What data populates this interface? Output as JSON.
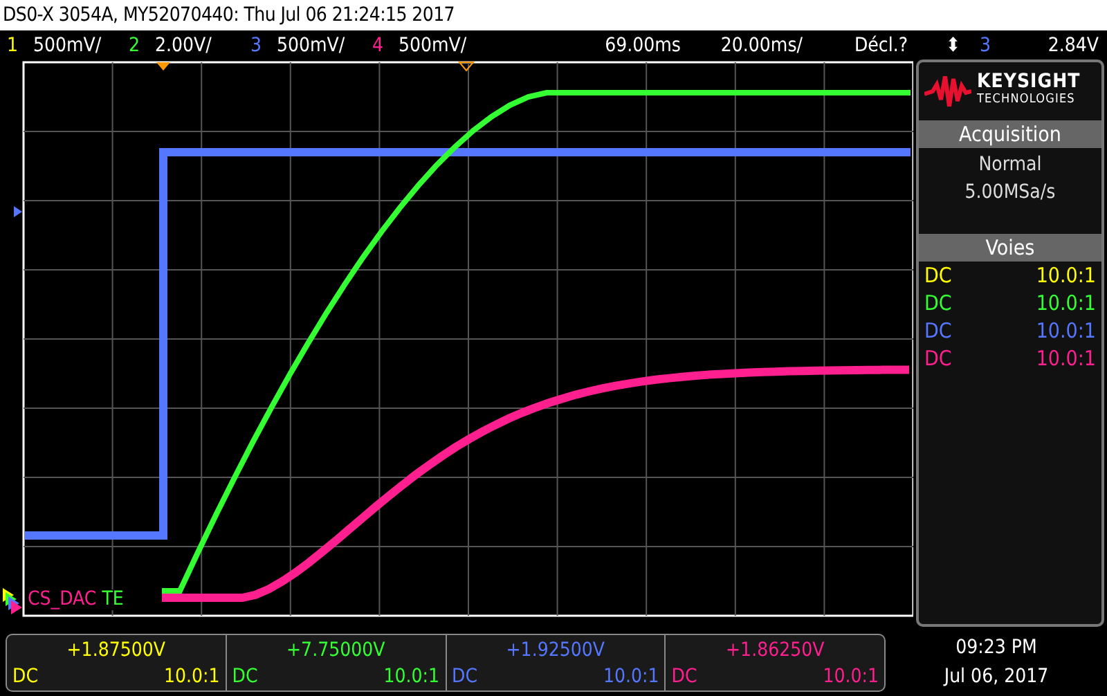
{
  "window": {
    "title": "DS0-X 3054A, MY52070440: Thu Jul 06 21:24:15 2017"
  },
  "channels": [
    {
      "number": "1",
      "scale": "500mV/",
      "color": "#ffff00"
    },
    {
      "number": "2",
      "scale": "2.00V/",
      "color": "#33ff33"
    },
    {
      "number": "3",
      "scale": "500mV/",
      "color": "#5577ff"
    },
    {
      "number": "4",
      "scale": "500mV/",
      "color": "#ff1f8f"
    }
  ],
  "timebase": {
    "delay": "69.00ms",
    "scale": "20.00ms/"
  },
  "trigger": {
    "mode": "Décl.?",
    "symbol": "⬍",
    "channel": "3",
    "color": "#5577ff",
    "level": "2.84V"
  },
  "plot": {
    "labels": [
      {
        "text": "CS_DAC",
        "color": "#ff1f8f"
      },
      {
        "text": "TE",
        "color": "#33ff33"
      }
    ]
  },
  "sidebar": {
    "brand": "KEYSIGHT",
    "brand_sub": "TECHNOLOGIES",
    "acquisition": {
      "title": "Acquisition",
      "mode": "Normal",
      "rate": "5.00MSa/s"
    },
    "channels_panel": {
      "title": "Voies",
      "rows": [
        {
          "coupling": "DC",
          "probe": "10.0:1",
          "color": "#ffff00"
        },
        {
          "coupling": "DC",
          "probe": "10.0:1",
          "color": "#33ff33"
        },
        {
          "coupling": "DC",
          "probe": "10.0:1",
          "color": "#5577ff"
        },
        {
          "coupling": "DC",
          "probe": "10.0:1",
          "color": "#ff1f8f"
        }
      ]
    }
  },
  "measurements": [
    {
      "value": "+1.87500V",
      "coupling": "DC",
      "probe": "10.0:1",
      "color": "#ffff00"
    },
    {
      "value": "+7.75000V",
      "coupling": "DC",
      "probe": "10.0:1",
      "color": "#33ff33"
    },
    {
      "value": "+1.92500V",
      "coupling": "DC",
      "probe": "10.0:1",
      "color": "#5577ff"
    },
    {
      "value": "+1.86250V",
      "coupling": "DC",
      "probe": "10.0:1",
      "color": "#ff1f8f"
    }
  ],
  "clock": {
    "time": "09:23 PM",
    "date": "Jul 06, 2017"
  }
}
